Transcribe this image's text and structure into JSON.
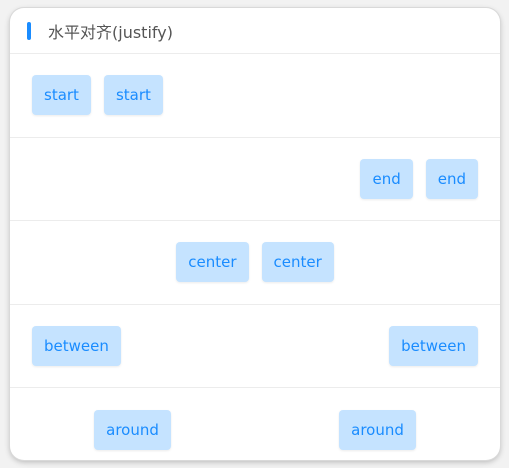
{
  "header": {
    "title": "水平对齐(justify)"
  },
  "rows": [
    {
      "mode": "start",
      "items": [
        "start",
        "start"
      ]
    },
    {
      "mode": "end",
      "items": [
        "end",
        "end"
      ]
    },
    {
      "mode": "center",
      "items": [
        "center",
        "center"
      ]
    },
    {
      "mode": "between",
      "items": [
        "between",
        "between"
      ]
    },
    {
      "mode": "around",
      "items": [
        "around",
        "around"
      ]
    }
  ],
  "colors": {
    "accent": "#1a8cff",
    "tag_bg": "#c5e3ff",
    "tag_text": "#1a8cff"
  }
}
